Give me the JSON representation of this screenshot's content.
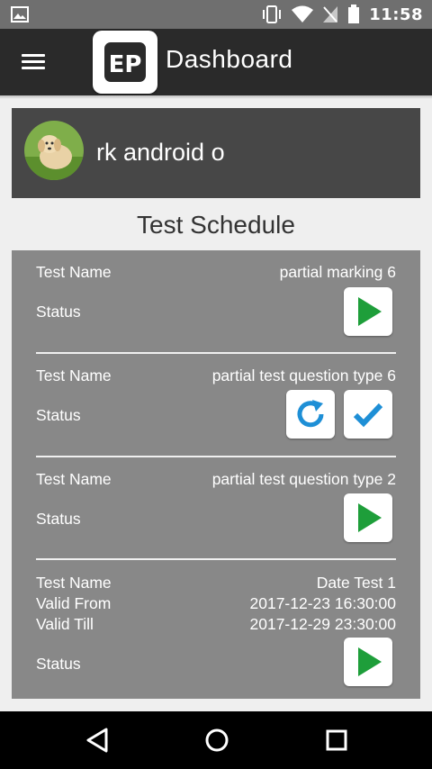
{
  "status_bar": {
    "time": "11:58"
  },
  "app_bar": {
    "title": "Dashboard",
    "logo_text": "EP"
  },
  "profile": {
    "username": "rk android o"
  },
  "section_title": "Test Schedule",
  "tests": [
    {
      "name_label": "Test Name",
      "name": "partial marking 6",
      "status_label": "Status",
      "actions": [
        "play"
      ]
    },
    {
      "name_label": "Test Name",
      "name": "partial test question type 6",
      "status_label": "Status",
      "actions": [
        "refresh",
        "check"
      ]
    },
    {
      "name_label": "Test Name",
      "name": "partial test question type 2",
      "status_label": "Status",
      "actions": [
        "play"
      ]
    },
    {
      "name_label": "Test Name",
      "name": "Date Test 1",
      "valid_from_label": "Valid From",
      "valid_from": "2017-12-23 16:30:00",
      "valid_till_label": "Valid Till",
      "valid_till": "2017-12-29 23:30:00",
      "status_label": "Status",
      "actions": [
        "play"
      ]
    }
  ],
  "colors": {
    "status_bar": "#6f6f6f",
    "app_bar": "#2a2a2a",
    "profile_card": "#474747",
    "panel": "#888888",
    "play_green": "#1e9e3a",
    "action_blue": "#1e8fd6"
  },
  "icons": {
    "status_left": "image-icon",
    "status_right": [
      "vibrate-icon",
      "wifi-icon",
      "no-sim-icon",
      "battery-icon"
    ],
    "nav": [
      "back-icon",
      "home-icon",
      "recents-icon"
    ]
  }
}
